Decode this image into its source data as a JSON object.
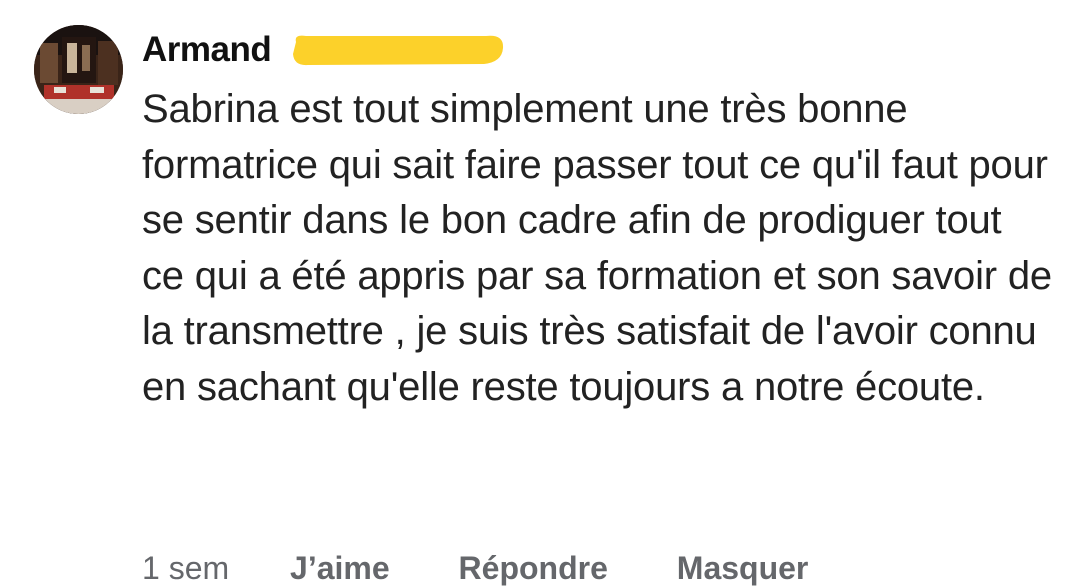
{
  "comment": {
    "author": "Armand",
    "text": "Sabrina est tout simplement une très bonne formatrice qui sait faire passer tout ce qu'il faut pour se sentir dans le bon cadre afin de prodiguer tout ce qui a été appris par sa formation et son savoir de la transmettre , je suis très satisfait de l'avoir connu en sachant qu'elle reste toujours a notre écoute.",
    "time": "1 sem",
    "actions": {
      "like": "J’aime",
      "reply": "Répondre",
      "hide": "Masquer"
    }
  },
  "colors": {
    "redaction_highlight": "#fcd12a",
    "secondary_text": "#65676b"
  },
  "icons": {
    "avatar": "user-photo-avatar"
  }
}
